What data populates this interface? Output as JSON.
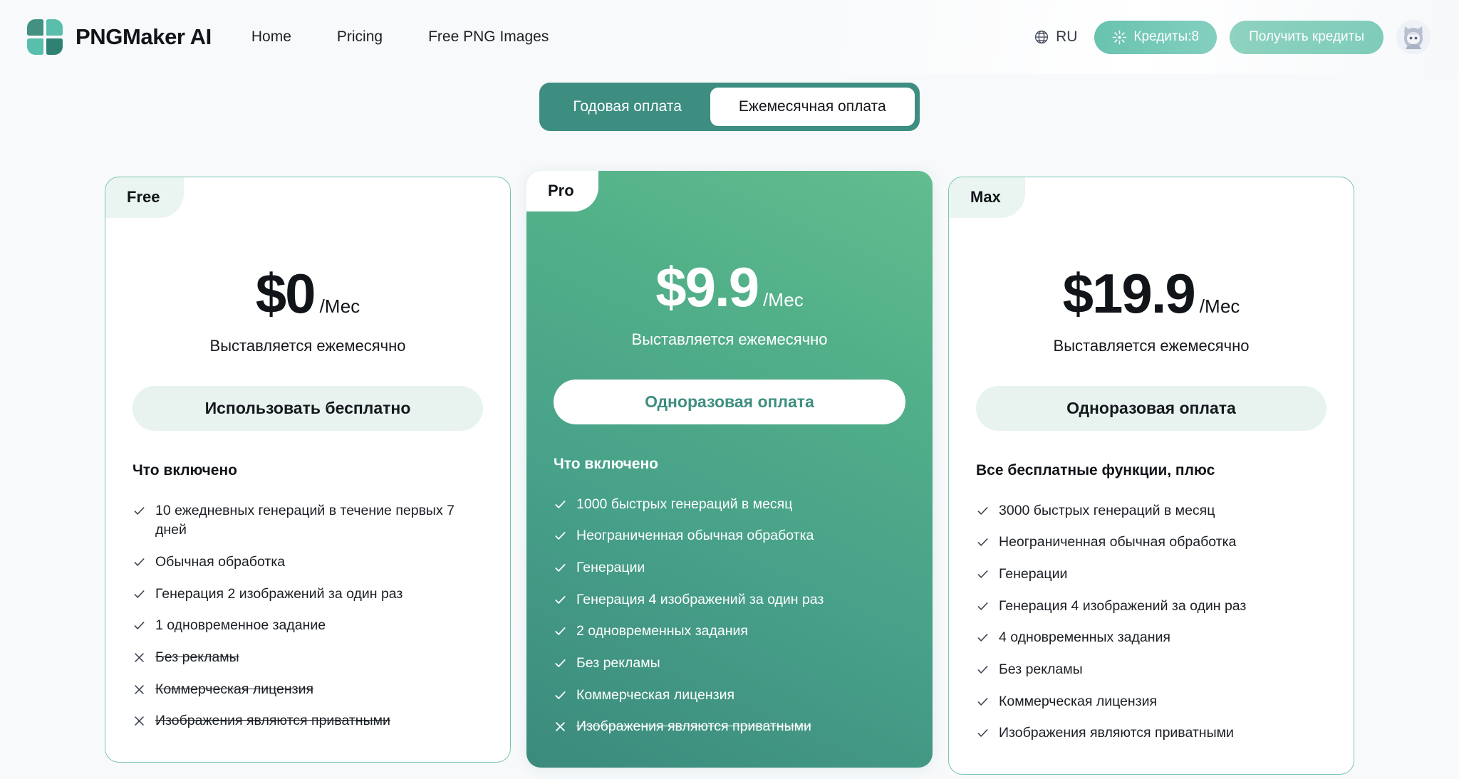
{
  "header": {
    "brand_name": "PNGMaker AI",
    "logo_icon": "four-petal-logo",
    "nav": [
      {
        "label": "Home"
      },
      {
        "label": "Pricing"
      },
      {
        "label": "Free PNG Images"
      }
    ],
    "language": {
      "code": "RU",
      "icon": "globe-icon"
    },
    "credits_button": {
      "label": "Кредиты:8",
      "icon": "sparkle-icon"
    },
    "get_credits_button": {
      "label": "Получить кредиты"
    },
    "avatar": {
      "icon": "cat-avatar-icon"
    }
  },
  "billing_toggle": {
    "annual": {
      "label": "Годовая оплата",
      "active": false
    },
    "monthly": {
      "label": "Ежемесячная оплата",
      "active": true
    }
  },
  "plans": [
    {
      "badge": "Free",
      "price": "$0",
      "period": "/Мес",
      "billed": "Выставляется ежемесячно",
      "cta": "Использовать бесплатно",
      "features_title": "Что включено",
      "features": [
        {
          "text": "10 ежедневных генераций в течение первых 7 дней",
          "included": true
        },
        {
          "text": "Обычная обработка",
          "included": true
        },
        {
          "text": "Генерация 2 изображений за один раз",
          "included": true
        },
        {
          "text": "1 одновременное задание",
          "included": true
        },
        {
          "text": "Без рекламы",
          "included": false
        },
        {
          "text": "Коммерческая лицензия",
          "included": false
        },
        {
          "text": "Изображения являются приватными",
          "included": false
        }
      ]
    },
    {
      "badge": "Pro",
      "price": "$9.9",
      "period": "/Мес",
      "billed": "Выставляется ежемесячно",
      "cta": "Одноразовая оплата",
      "features_title": "Что включено",
      "features": [
        {
          "text": "1000 быстрых генераций в месяц",
          "included": true
        },
        {
          "text": "Неограниченная обычная обработка",
          "included": true
        },
        {
          "text": "Генерации",
          "included": true
        },
        {
          "text": "Генерация 4 изображений за один раз",
          "included": true
        },
        {
          "text": "2 одновременных задания",
          "included": true
        },
        {
          "text": "Без рекламы",
          "included": true
        },
        {
          "text": "Коммерческая лицензия",
          "included": true
        },
        {
          "text": "Изображения являются приватными",
          "included": false
        }
      ]
    },
    {
      "badge": "Max",
      "price": "$19.9",
      "period": "/Мес",
      "billed": "Выставляется ежемесячно",
      "cta": "Одноразовая оплата",
      "features_title": "Все бесплатные функции, плюс",
      "features": [
        {
          "text": "3000 быстрых генераций в месяц",
          "included": true
        },
        {
          "text": "Неограниченная обычная обработка",
          "included": true
        },
        {
          "text": "Генерации",
          "included": true
        },
        {
          "text": "Генерация 4 изображений за один раз",
          "included": true
        },
        {
          "text": "4 одновременных задания",
          "included": true
        },
        {
          "text": "Без рекламы",
          "included": true
        },
        {
          "text": "Коммерческая лицензия",
          "included": true
        },
        {
          "text": "Изображения являются приватными",
          "included": true
        }
      ]
    }
  ],
  "colors": {
    "page_bg": "#f7f9fb",
    "brand_teal": "#3d8e81",
    "card_border": "#7cc4b4",
    "featured_gradient_from": "#62bd8f",
    "featured_gradient_to": "#3b8a7c",
    "mint_button": "#e8f3f0"
  }
}
